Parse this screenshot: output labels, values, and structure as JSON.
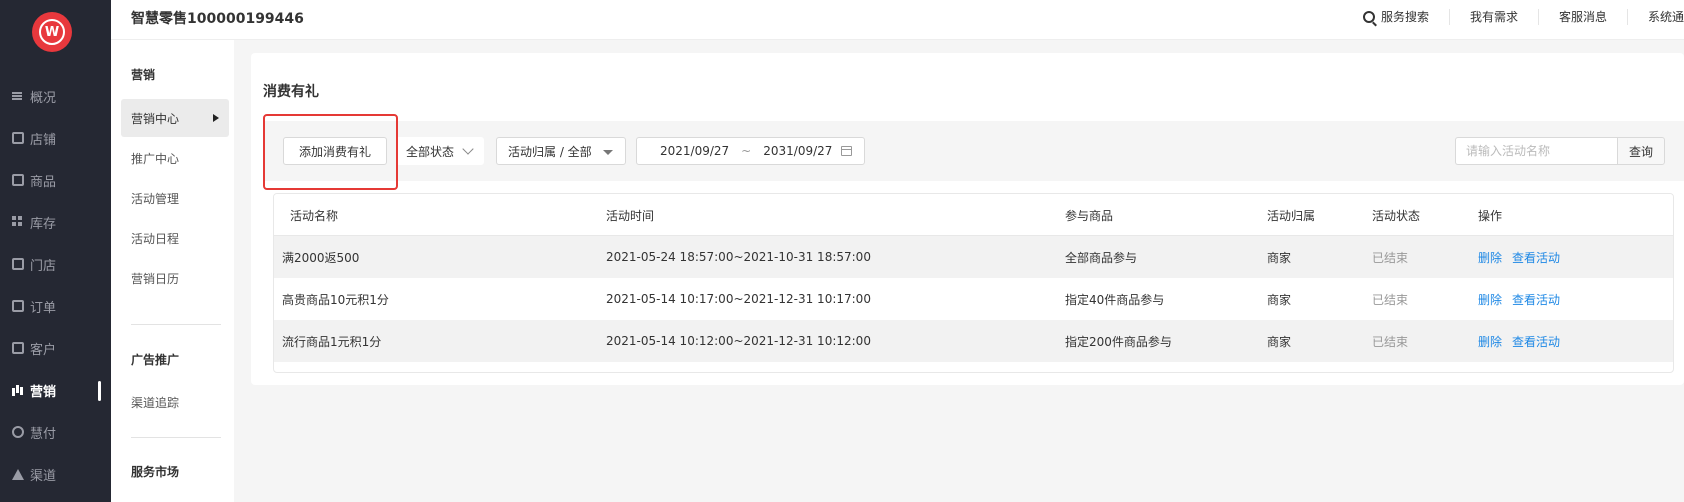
{
  "brand": {
    "logo_glyph": "W",
    "title": "智慧零售100000199446"
  },
  "topbar": {
    "search": "服务搜索",
    "needs": "我有需求",
    "service": "客服消息",
    "system": "系统通"
  },
  "nav": {
    "items": [
      {
        "label": "概况",
        "icon": "overview-icon"
      },
      {
        "label": "店铺",
        "icon": "shop-icon"
      },
      {
        "label": "商品",
        "icon": "goods-icon"
      },
      {
        "label": "库存",
        "icon": "stock-icon"
      },
      {
        "label": "门店",
        "icon": "store-icon"
      },
      {
        "label": "订单",
        "icon": "order-icon"
      },
      {
        "label": "客户",
        "icon": "customer-icon"
      },
      {
        "label": "营销",
        "icon": "marketing-icon"
      },
      {
        "label": "慧付",
        "icon": "pay-icon"
      },
      {
        "label": "渠道",
        "icon": "channel-icon"
      }
    ],
    "active": "营销"
  },
  "subnav": {
    "heading1": "营销",
    "items1": [
      "营销中心",
      "推广中心",
      "活动管理",
      "活动日程",
      "营销日历"
    ],
    "heading2": "广告推广",
    "items2": [
      "渠道追踪"
    ],
    "heading3": "服务市场"
  },
  "page": {
    "title": "消费有礼"
  },
  "toolbar": {
    "add_button": "添加消费有礼",
    "status_select": "全部状态",
    "owner_select": "活动归属 / 全部",
    "date_start": "2021/09/27",
    "date_sep": "~",
    "date_end": "2031/09/27",
    "search_placeholder": "请输入活动名称",
    "query_button": "查询"
  },
  "table": {
    "headers": [
      "活动名称",
      "活动时间",
      "参与商品",
      "活动归属",
      "活动状态",
      "操作"
    ],
    "rows": [
      {
        "name": "满2000返500",
        "time": "2021-05-24 18:57:00~2021-10-31 18:57:00",
        "goods": "全部商品参与",
        "owner": "商家",
        "status": "已结束",
        "op1": "删除",
        "op2": "查看活动"
      },
      {
        "name": "高贵商品10元积1分",
        "time": "2021-05-14 10:17:00~2021-12-31 10:17:00",
        "goods": "指定40件商品参与",
        "owner": "商家",
        "status": "已结束",
        "op1": "删除",
        "op2": "查看活动"
      },
      {
        "name": "流行商品1元积1分",
        "time": "2021-05-14 10:12:00~2021-12-31 10:12:00",
        "goods": "指定200件商品参与",
        "owner": "商家",
        "status": "已结束",
        "op1": "删除",
        "op2": "查看活动"
      }
    ]
  },
  "colors": {
    "accent_link": "#1e88e5",
    "nav_bg": "#252833",
    "highlight": "#e53935",
    "logo": "#e8383d"
  }
}
